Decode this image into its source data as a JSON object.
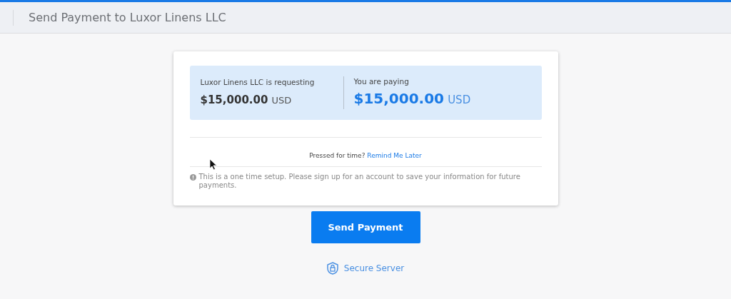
{
  "header": {
    "title": "Send Payment to Luxor Linens LLC"
  },
  "summary": {
    "requesting": {
      "label": "Luxor Linens LLC is requesting",
      "amount": "$15,000.00",
      "currency": "USD"
    },
    "paying": {
      "label": "You are paying",
      "amount": "$15,000.00",
      "currency": "USD"
    }
  },
  "reminder": {
    "text": "Pressed for time?",
    "link": "Remind Me Later"
  },
  "notice": "This is a one time setup. Please sign up for an account to save your information for future payments.",
  "send_button": "Send Payment",
  "secure_label": "Secure Server"
}
